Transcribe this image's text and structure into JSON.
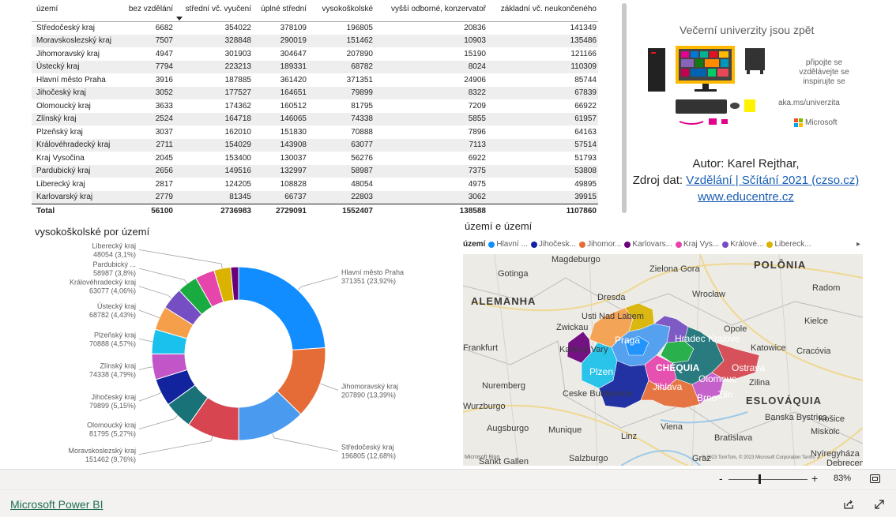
{
  "table": {
    "columns": [
      "území",
      "bez vzdělání",
      "střední vč. vyučení",
      "úplné střední",
      "vysokoškolské",
      "vyšší odborné, konzervatoř",
      "základní vč. neukončeného"
    ],
    "rows": [
      [
        "Středočeský kraj",
        "6682",
        "354022",
        "378109",
        "196805",
        "20836",
        "141349"
      ],
      [
        "Moravskoslezský kraj",
        "7507",
        "328848",
        "290019",
        "151462",
        "10903",
        "135486"
      ],
      [
        "Jihomoravský kraj",
        "4947",
        "301903",
        "304647",
        "207890",
        "15190",
        "121166"
      ],
      [
        "Ústecký kraj",
        "7794",
        "223213",
        "189331",
        "68782",
        "8024",
        "110309"
      ],
      [
        "Hlavní město Praha",
        "3916",
        "187885",
        "361420",
        "371351",
        "24906",
        "85744"
      ],
      [
        "Jihočeský kraj",
        "3052",
        "177527",
        "164651",
        "79899",
        "8322",
        "67839"
      ],
      [
        "Olomoucký kraj",
        "3633",
        "174362",
        "160512",
        "81795",
        "7209",
        "66922"
      ],
      [
        "Zlínský kraj",
        "2524",
        "164718",
        "146065",
        "74338",
        "5855",
        "61957"
      ],
      [
        "Plzeňský kraj",
        "3037",
        "162010",
        "151830",
        "70888",
        "7896",
        "64163"
      ],
      [
        "Královéhradecký kraj",
        "2711",
        "154029",
        "143908",
        "63077",
        "7113",
        "57514"
      ],
      [
        "Kraj Vysočina",
        "2045",
        "153400",
        "130037",
        "56276",
        "6922",
        "51793"
      ],
      [
        "Pardubický kraj",
        "2656",
        "149516",
        "132997",
        "58987",
        "7375",
        "53808"
      ],
      [
        "Liberecký kraj",
        "2817",
        "124205",
        "108828",
        "48054",
        "4975",
        "49895"
      ],
      [
        "Karlovarský kraj",
        "2779",
        "81345",
        "66737",
        "22803",
        "3062",
        "39915"
      ]
    ],
    "total": [
      "Total",
      "56100",
      "2736983",
      "2729091",
      "1552407",
      "138588",
      "1107860"
    ]
  },
  "ad": {
    "title": "Večerní univerzity jsou zpět",
    "lines": [
      "připojte se",
      "vzdělávejte se",
      "inspirujte se"
    ],
    "link": "aka.ms/univerzita",
    "brand": "Microsoft"
  },
  "author": {
    "line1": "Autor: Karel Rejthar,",
    "source_prefix": "Zdroj dat: ",
    "source_link": "Vzdělání | Sčítání 2021 (czso.cz)",
    "website": "www.educentre.cz"
  },
  "donut": {
    "title": "vysokoškolské por území",
    "chart_data": {
      "type": "pie",
      "title": "vysokoškolské por území",
      "slices": [
        {
          "label": "Hlavní město Praha",
          "value": 371351,
          "pct": "23,92%",
          "color": "#118dff"
        },
        {
          "label": "Jihomoravský kraj",
          "value": 207890,
          "pct": "13,39%",
          "color": "#e66c37"
        },
        {
          "label": "Středočeský kraj",
          "value": 196805,
          "pct": "12,68%",
          "color": "#4a9bf0"
        },
        {
          "label": "Moravskoslezský kraj",
          "value": 151462,
          "pct": "9,76%",
          "color": "#d64550"
        },
        {
          "label": "Olomoucký kraj",
          "value": 81795,
          "pct": "5,27%",
          "color": "#197278"
        },
        {
          "label": "Jihočeský kraj",
          "value": 79899,
          "pct": "5,15%",
          "color": "#12239e"
        },
        {
          "label": "Zlínský kraj",
          "value": 74338,
          "pct": "4,79%",
          "color": "#c256c8"
        },
        {
          "label": "Plzeňský kraj",
          "value": 70888,
          "pct": "4,57%",
          "color": "#1ac1ec"
        },
        {
          "label": "Ústecký kraj",
          "value": 68782,
          "pct": "4,43%",
          "color": "#f59f4a"
        },
        {
          "label": "Královéhradecký kraj",
          "value": 63077,
          "pct": "4,06%",
          "color": "#744ec2"
        },
        {
          "label": "Pardubický ...",
          "value": 58987,
          "pct": "3,8%",
          "color": "#1aab40"
        },
        {
          "label": "Kraj Vysočina",
          "value": 56276,
          "pct": "3,63%",
          "color": "#e645ab"
        },
        {
          "label": "Liberecký kraj",
          "value": 48054,
          "pct": "3,1%",
          "color": "#d9b300"
        },
        {
          "label": "Karlovarský kraj",
          "value": 22803,
          "pct": "1,47%",
          "color": "#6b007b"
        }
      ]
    }
  },
  "map": {
    "title": "území e území",
    "legend_title": "území",
    "legend": [
      {
        "label": "Hlavní ...",
        "color": "#118dff"
      },
      {
        "label": "Jihočesk...",
        "color": "#12239e"
      },
      {
        "label": "Jihomor...",
        "color": "#e66c37"
      },
      {
        "label": "Karlovars...",
        "color": "#6b007b"
      },
      {
        "label": "Kraj Vys...",
        "color": "#e645ab"
      },
      {
        "label": "Královė...",
        "color": "#744ec2"
      },
      {
        "label": "Libereck...",
        "color": "#d9b300"
      }
    ],
    "cities": [
      "Magdeburgo",
      "Zielona Gora",
      "Gotinga",
      "POLÔNIA",
      "ALEMANHA",
      "Dresda",
      "Wrocław",
      "Radom",
      "Usti Nad Labem",
      "Kielce",
      "Zwickau",
      "Opole",
      "Frankfurt",
      "Praga",
      "Hradec Kralove",
      "Katowice",
      "Cracóvia",
      "Karlovy Vary",
      "Plzen",
      "CHÉQUIA",
      "Ostrava",
      "Nuremberg",
      "Olomouc",
      "Zilina",
      "Jihlava",
      "Ceske Budejovice",
      "Brno",
      "Zlin",
      "Wurzburgo",
      "ESLOVÁQUIA",
      "Banska Bystrica",
      "Košice",
      "Munique",
      "Viena",
      "Linz",
      "Bratislava",
      "Miskolc",
      "Augsburgo",
      "Nyíregyháza",
      "Salzburgo",
      "Sankt Gallen",
      "Graz",
      "Debrecen"
    ],
    "copyright": "© 2023 TomTom, © 2023 Microsoft Corporation  Terms",
    "bing": "Microsoft Bing"
  },
  "zoom": {
    "level": "83%",
    "minus": "-",
    "plus": "+"
  },
  "footer": {
    "brand": "Microsoft Power BI"
  }
}
